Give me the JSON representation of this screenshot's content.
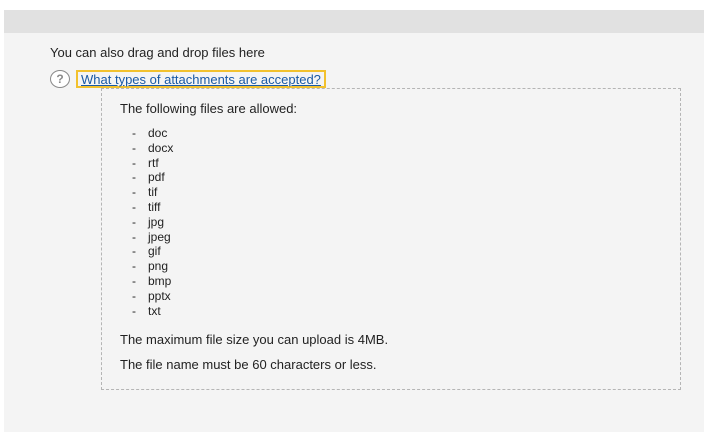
{
  "upload": {
    "drag_text": "You can also drag and drop files here",
    "help_icon": "question-circle-icon",
    "help_icon_glyph": "?",
    "help_link": "What types of attachments are accepted?",
    "info": {
      "intro": "The following files are allowed:",
      "bullet": "-",
      "file_types": [
        "doc",
        "docx",
        "rtf",
        "pdf",
        "tif",
        "tiff",
        "jpg",
        "jpeg",
        "gif",
        "png",
        "bmp",
        "pptx",
        "txt"
      ],
      "max_size": "The maximum file size you can upload is 4MB.",
      "name_limit": "The file name must be 60 characters or less."
    }
  },
  "colors": {
    "link": "#1a5aa6",
    "focus_outline": "#f2c12e",
    "panel_bg": "#f4f4f4",
    "top_bar": "#e1e1e1"
  }
}
